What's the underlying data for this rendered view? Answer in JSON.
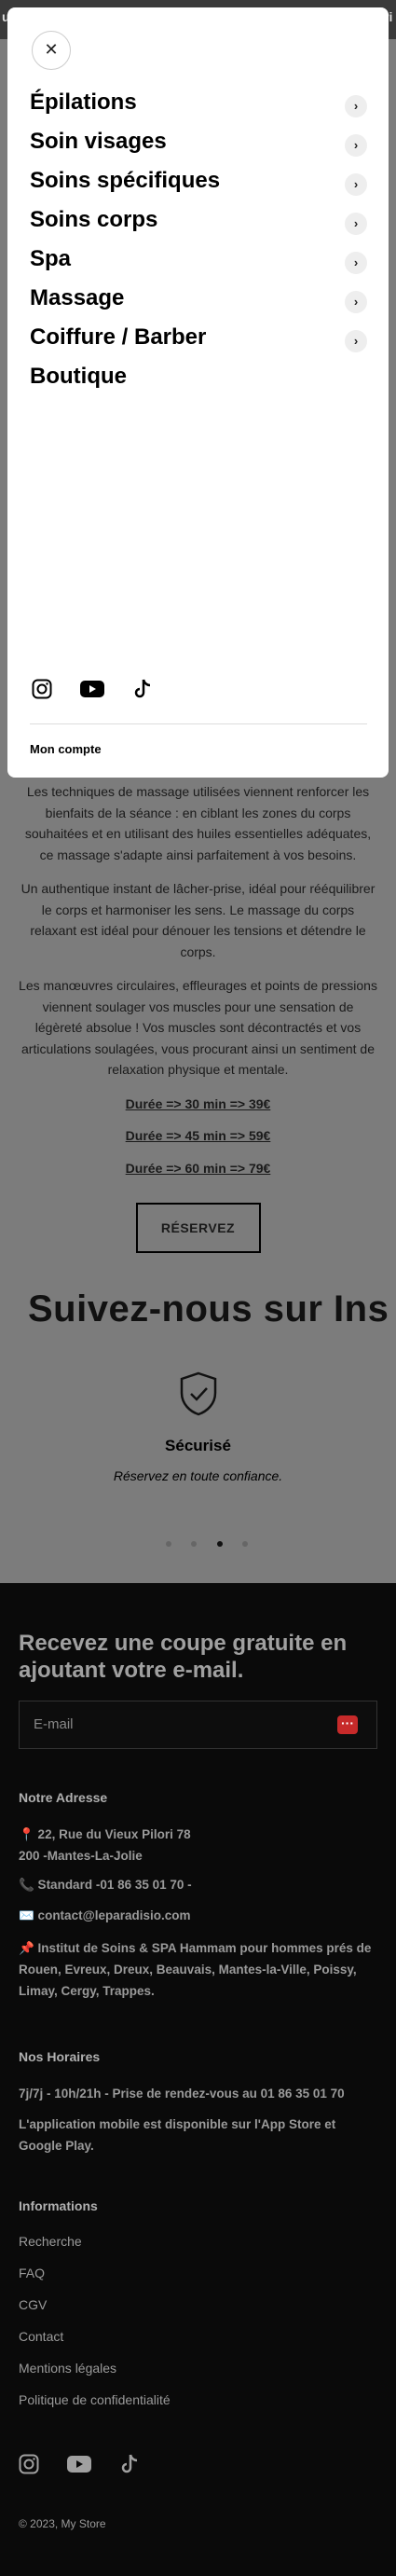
{
  "topbar": {
    "left_text": "u",
    "right_text": "ri"
  },
  "drawer": {
    "close_label": "✕",
    "menu": [
      {
        "label": "Épilations",
        "has_sub": true
      },
      {
        "label": "Soin visages",
        "has_sub": true
      },
      {
        "label": "Soins spécifiques",
        "has_sub": true
      },
      {
        "label": "Soins corps",
        "has_sub": true
      },
      {
        "label": "Spa",
        "has_sub": true
      },
      {
        "label": "Massage",
        "has_sub": true
      },
      {
        "label": "Coiffure / Barber",
        "has_sub": true
      },
      {
        "label": "Boutique",
        "has_sub": false
      }
    ],
    "social_icons": [
      "instagram-icon",
      "youtube-icon",
      "tiktok-icon"
    ],
    "account_label": "Mon compte"
  },
  "content": {
    "paragraphs": [
      "Les techniques de massage utilisées viennent renforcer les bienfaits de la séance : en ciblant les zones du corps souhaitées et en utilisant des huiles essentielles adéquates, ce massage s'adapte ainsi parfaitement à vos besoins.",
      "Un authentique instant de lâcher-prise, idéal pour rééquilibrer le corps et harmoniser les sens. Le massage du corps relaxant est idéal pour dénouer les tensions et détendre le corps.",
      "Les manœuvres circulaires, effleurages et points de pressions viennent soulager vos muscles pour une sensation de légèreté absolue ! Vos muscles sont décontractés et vos articulations soulagées, vous procurant ainsi un sentiment de relaxation physique et mentale."
    ],
    "prices": [
      "Durée => 30 min => 39€",
      "Durée => 45 min => 59€",
      "Durée => 60 min => 79€"
    ],
    "reserve_label": "RÉSERVEZ"
  },
  "follow_title": "Suivez-nous sur Ins",
  "secure": {
    "title": "Sécurisé",
    "subtitle": "Réservez en toute confiance."
  },
  "carousel": {
    "count": 4,
    "active_index": 2
  },
  "footer": {
    "newsletter_title": "Recevez une coupe gratuite en ajoutant votre e-mail.",
    "email_placeholder": "E-mail",
    "address_title": "Notre Adresse",
    "address": "📍 22, Rue du Vieux Pilori 78 200 -Mantes-La-Jolie",
    "phone": "📞 Standard -01 86 35 01 70 -",
    "email": "✉️ contact@leparadisio.com",
    "institute": "📌 Institut de Soins & SPA Hammam pour hommes prés de Rouen, Evreux, Dreux, Beauvais, Mantes-la-Ville, Poissy, Limay, Cergy, Trappes.",
    "hours_title": "Nos Horaires",
    "hours": "7j/7j - 10h/21h - Prise de rendez-vous au 01 86 35 01 70",
    "app_note": "L'application mobile est disponible sur l'App Store et Google Play.",
    "info_title": "Informations",
    "links": [
      "Recherche",
      "FAQ",
      "CGV",
      "Contact",
      "Mentions légales",
      "Politique de confidentialité"
    ],
    "copyright": "© 2023, My Store"
  }
}
